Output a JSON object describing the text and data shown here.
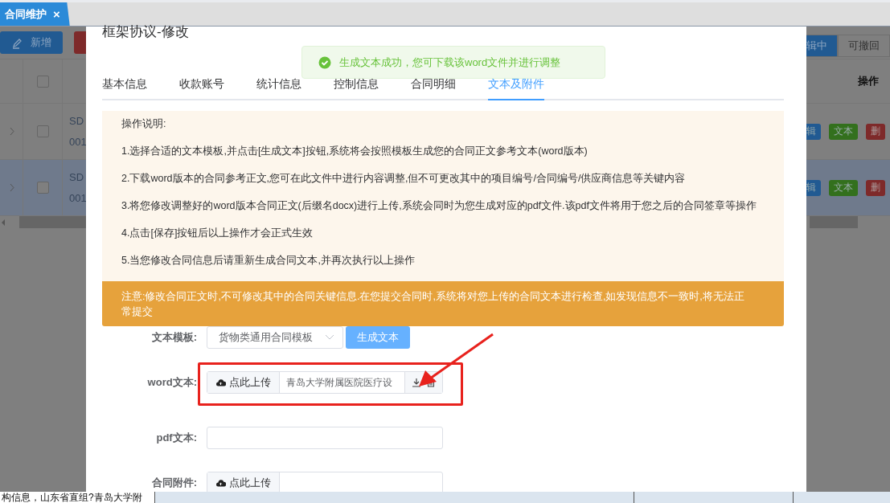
{
  "tab_bar": {
    "tabs": [
      {
        "label": "合同维护",
        "close": "×",
        "selected": true
      }
    ]
  },
  "toolbar": {
    "buttons": [
      {
        "label": "新增",
        "kind": "add"
      },
      {
        "kind": "danger"
      }
    ],
    "status_tabs": [
      {
        "label": "辑中",
        "selected": true
      },
      {
        "label": "可撤回",
        "selected": false
      }
    ]
  },
  "table": {
    "columns": [
      {
        "label": "操作"
      }
    ],
    "header_checked": false,
    "rows": [
      {
        "code": "SD",
        "number": "001",
        "checked": false,
        "selected": false,
        "actions": [
          {
            "label": "辑",
            "kind": "edit"
          },
          {
            "label": "文本",
            "kind": "text"
          },
          {
            "label": "删",
            "kind": "delete"
          }
        ]
      },
      {
        "code": "SD",
        "number": "001",
        "checked": false,
        "selected": true,
        "actions": [
          {
            "label": "辑",
            "kind": "edit"
          },
          {
            "label": "文本",
            "kind": "text"
          },
          {
            "label": "删",
            "kind": "delete"
          }
        ]
      }
    ]
  },
  "modal": {
    "title": "框架协议-修改",
    "toast": {
      "text": "生成文本成功，您可下载该word文件并进行调整",
      "kind": "success"
    },
    "tabs": [
      {
        "label": "基本信息",
        "selected": false
      },
      {
        "label": "收款账号",
        "selected": false
      },
      {
        "label": "统计信息",
        "selected": false
      },
      {
        "label": "控制信息",
        "selected": false
      },
      {
        "label": "合同明细",
        "selected": false
      },
      {
        "label": "文本及附件",
        "selected": true
      }
    ],
    "instructions": {
      "heading": "操作说明:",
      "items": [
        "1.选择合适的文本模板,并点击[生成文本]按钮,系统将会按照模板生成您的合同正文参考文本(word版本)",
        "2.下载word版本的合同参考正文,您可在此文件中进行内容调整,但不可更改其中的项目编号/合同编号/供应商信息等关键内容",
        "3.将您修改调整好的word版本合同正文(后缀名docx)进行上传,系统会同时为您生成对应的pdf文件.该pdf文件将用于您之后的合同签章等操作",
        "4.点击[保存]按钮后以上操作才会正式生效",
        "5.当您修改合同信息后请重新生成合同文本,并再次执行以上操作"
      ]
    },
    "warning": "注意:修改合同正文时,不可修改其中的合同关键信息.在您提交合同时,系统将对您上传的合同文本进行检查,如发现信息不一致时,将无法正常提交",
    "form": [
      {
        "kind": "select",
        "label": "文本模板:",
        "value": "货物类通用合同模板",
        "button": "生成文本"
      },
      {
        "kind": "upload",
        "label": "word文本:",
        "button": "点此上传",
        "file": "青岛大学附属医院医疗设",
        "highlighted": true
      },
      {
        "kind": "text",
        "label": "pdf文本:"
      },
      {
        "kind": "upload",
        "label": "合同附件:",
        "button": "点此上传",
        "highlighted": false
      }
    ]
  },
  "status_bar": {
    "text": "构信息，山东省直组?青岛大学附"
  }
}
